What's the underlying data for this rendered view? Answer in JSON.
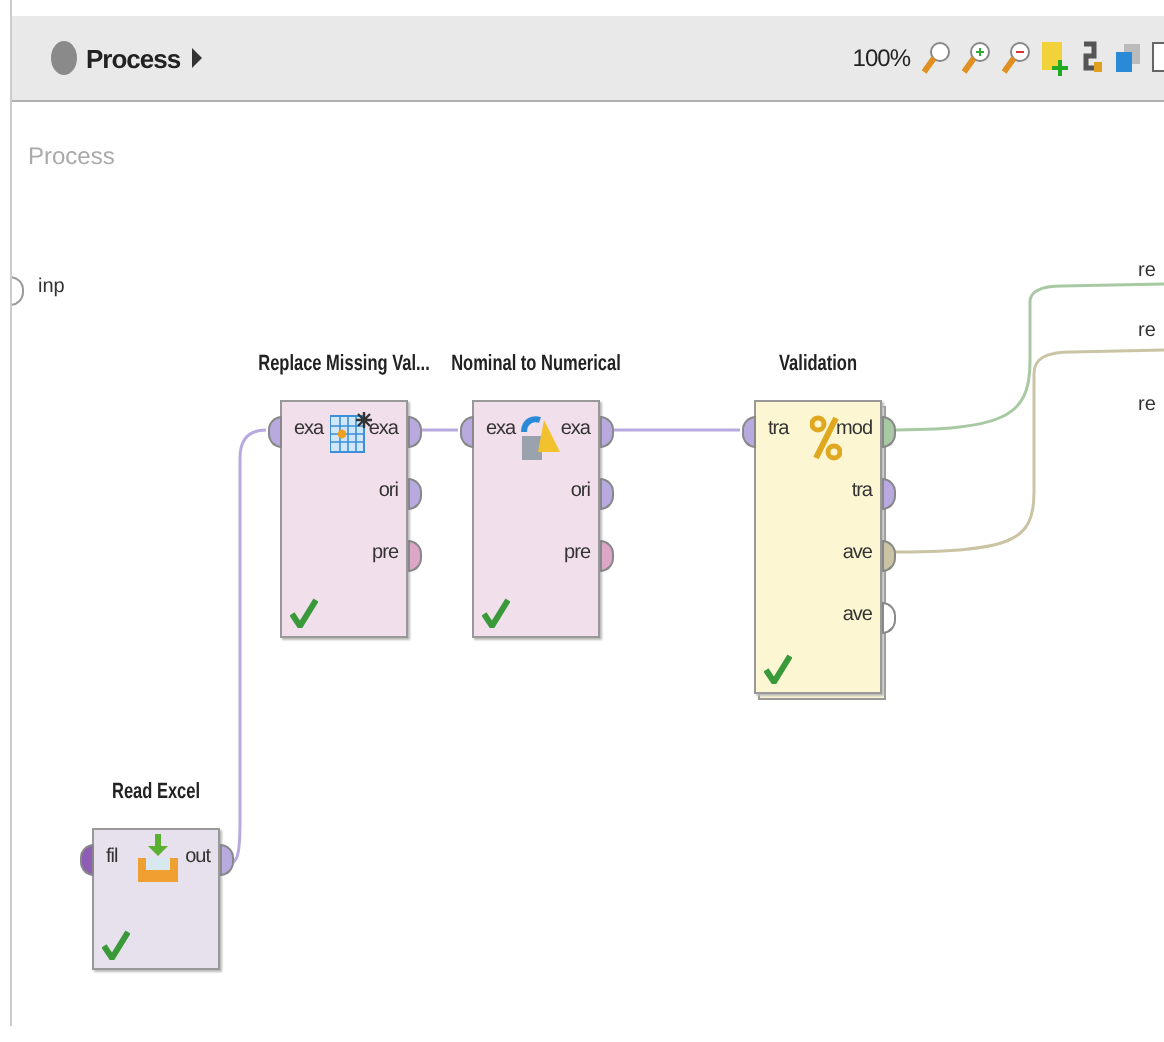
{
  "toolbar": {
    "breadcrumb": "Process",
    "zoom": "100%"
  },
  "canvas": {
    "label": "Process",
    "input_ports": [
      "inp"
    ],
    "result_ports": [
      "re",
      "re",
      "re"
    ]
  },
  "operators": [
    {
      "title": "Replace Missing Val...",
      "done": true,
      "inputs": [
        {
          "label": "exa",
          "color": "#b8aadf"
        }
      ],
      "outputs": [
        {
          "label": "exa",
          "color": "#b8aadf"
        },
        {
          "label": "ori",
          "color": "#b8aadf"
        },
        {
          "label": "pre",
          "color": "#dca6c6"
        }
      ]
    },
    {
      "title": "Nominal to Numerical",
      "done": true,
      "inputs": [
        {
          "label": "exa",
          "color": "#b8aadf"
        }
      ],
      "outputs": [
        {
          "label": "exa",
          "color": "#b8aadf"
        },
        {
          "label": "ori",
          "color": "#b8aadf"
        },
        {
          "label": "pre",
          "color": "#dca6c6"
        }
      ]
    },
    {
      "title": "Validation",
      "done": true,
      "inputs": [
        {
          "label": "tra",
          "color": "#b8aadf"
        }
      ],
      "outputs": [
        {
          "label": "mod",
          "color": "#a9c9a4"
        },
        {
          "label": "tra",
          "color": "#b8aadf"
        },
        {
          "label": "ave",
          "color": "#cbc4a4"
        },
        {
          "label": "ave",
          "color": "#ffffff"
        }
      ]
    },
    {
      "title": "Read Excel",
      "done": true,
      "inputs": [
        {
          "label": "fil",
          "color": "#8e5bb5"
        }
      ],
      "outputs": [
        {
          "label": "out",
          "color": "#b8aadf"
        }
      ]
    }
  ]
}
